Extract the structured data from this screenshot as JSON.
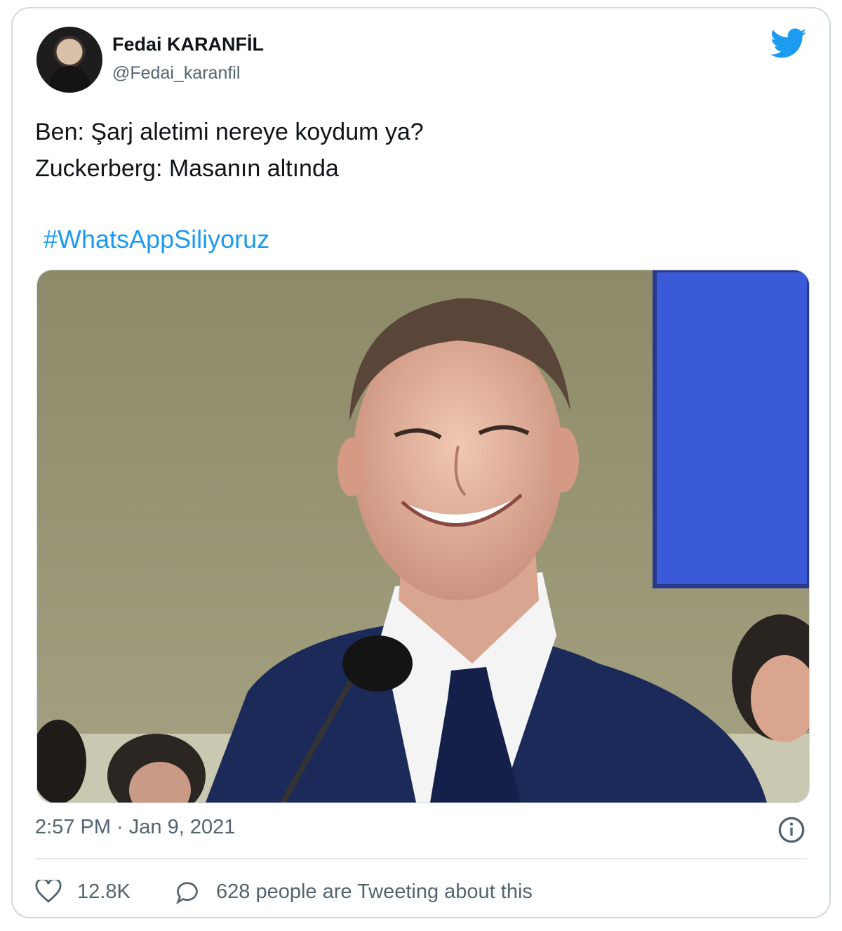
{
  "tweet": {
    "author_name": "Fedai KARANFİL",
    "author_handle": "@Fedai_karanfil",
    "text_line1": "Ben: Şarj aletimi nereye koydum ya?",
    "text_line2": "Zuckerberg: Masanın altında",
    "hashtag": "#WhatsAppSiliyoruz",
    "timestamp": "2:57 PM · Jan 9, 2021",
    "like_count": "12.8K",
    "tweeting_about": "628 people are Tweeting about this"
  },
  "icons": {
    "platform": "twitter-bird-icon",
    "info": "info-icon",
    "like": "heart-icon",
    "reply": "speech-bubble-icon"
  },
  "colors": {
    "brand": "#1d9bf0",
    "text": "#0f1419",
    "muted": "#536471",
    "border": "#cfd9de"
  }
}
